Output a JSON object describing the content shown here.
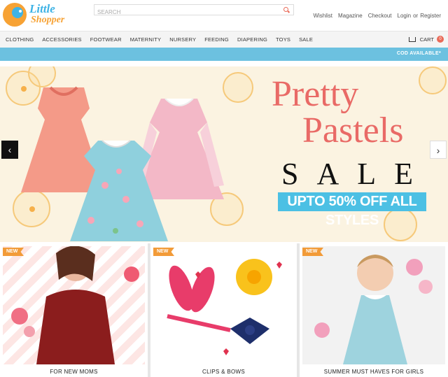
{
  "brand": {
    "line1": "Little",
    "line2": "Shopper"
  },
  "search": {
    "placeholder": "SEARCH"
  },
  "top_links": [
    "Wishlist",
    "Magazine",
    "Checkout",
    "Login",
    "or",
    "Register"
  ],
  "nav": {
    "items": [
      "CLOTHING",
      "ACCESSORIES",
      "FOOTWEAR",
      "MATERNITY",
      "NURSERY",
      "FEEDING",
      "DIAPERING",
      "TOYS",
      "SALE"
    ],
    "cart_label": "CART",
    "cart_count": "0"
  },
  "cod_bar": {
    "text": "COD AVAILABLE*"
  },
  "banner": {
    "line1": "Pretty",
    "line2": "Pastels",
    "sale": "SALE",
    "offer": "UPTO 50% OFF ALL STYLES",
    "prev_arrow": "‹",
    "next_arrow": "›"
  },
  "tiles": [
    {
      "badge": "NEW",
      "caption": "FOR NEW MOMS"
    },
    {
      "badge": "NEW",
      "caption": "CLIPS & BOWS"
    },
    {
      "badge": "NEW",
      "caption": "SUMMER MUST HAVES FOR GIRLS"
    }
  ],
  "colors": {
    "accent": "#e96a66",
    "sky": "#6cc1e0",
    "offer_bg": "#4cc0e4",
    "badge": "#f29b38",
    "banner_bg": "#fbf3e1"
  },
  "icons": [
    "bird-logo-icon",
    "search-icon",
    "cart-icon",
    "chevron-left-icon",
    "chevron-right-icon"
  ]
}
